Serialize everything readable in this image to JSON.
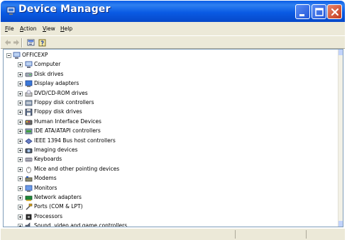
{
  "window": {
    "title": "Device Manager"
  },
  "menu": [
    {
      "key": "file",
      "label": "File",
      "mnemonic_index": 0
    },
    {
      "key": "action",
      "label": "Action",
      "mnemonic_index": 0
    },
    {
      "key": "view",
      "label": "View",
      "mnemonic_index": 0
    },
    {
      "key": "help",
      "label": "Help",
      "mnemonic_index": 0
    }
  ],
  "toolbar": {
    "icons": [
      "back-arrow-icon",
      "forward-arrow-icon",
      "properties-icon",
      "help-icon"
    ]
  },
  "tree": {
    "root": {
      "label": "OFFICEXP",
      "icon": "computer-icon",
      "expanded": true
    },
    "items": [
      {
        "label": "Computer",
        "icon": "computer-icon"
      },
      {
        "label": "Disk drives",
        "icon": "disk-drive-icon"
      },
      {
        "label": "Display adapters",
        "icon": "display-adapter-icon"
      },
      {
        "label": "DVD/CD-ROM drives",
        "icon": "cdrom-icon"
      },
      {
        "label": "Floppy disk controllers",
        "icon": "floppy-controller-icon"
      },
      {
        "label": "Floppy disk drives",
        "icon": "floppy-drive-icon"
      },
      {
        "label": "Human Interface Devices",
        "icon": "hid-icon"
      },
      {
        "label": "IDE ATA/ATAPI controllers",
        "icon": "ide-controller-icon"
      },
      {
        "label": "IEEE 1394 Bus host controllers",
        "icon": "ieee1394-icon"
      },
      {
        "label": "Imaging devices",
        "icon": "imaging-device-icon"
      },
      {
        "label": "Keyboards",
        "icon": "keyboard-icon"
      },
      {
        "label": "Mice and other pointing devices",
        "icon": "mouse-icon"
      },
      {
        "label": "Modems",
        "icon": "modem-icon"
      },
      {
        "label": "Monitors",
        "icon": "monitor-icon"
      },
      {
        "label": "Network adapters",
        "icon": "network-adapter-icon"
      },
      {
        "label": "Ports (COM & LPT)",
        "icon": "port-icon"
      },
      {
        "label": "Processors",
        "icon": "processor-icon"
      },
      {
        "label": "Sound, video and game controllers",
        "icon": "sound-icon"
      }
    ]
  },
  "colors": {
    "titlebar": "#0a5ce6",
    "chrome": "#ece9d8",
    "close_button": "#c4391c"
  }
}
